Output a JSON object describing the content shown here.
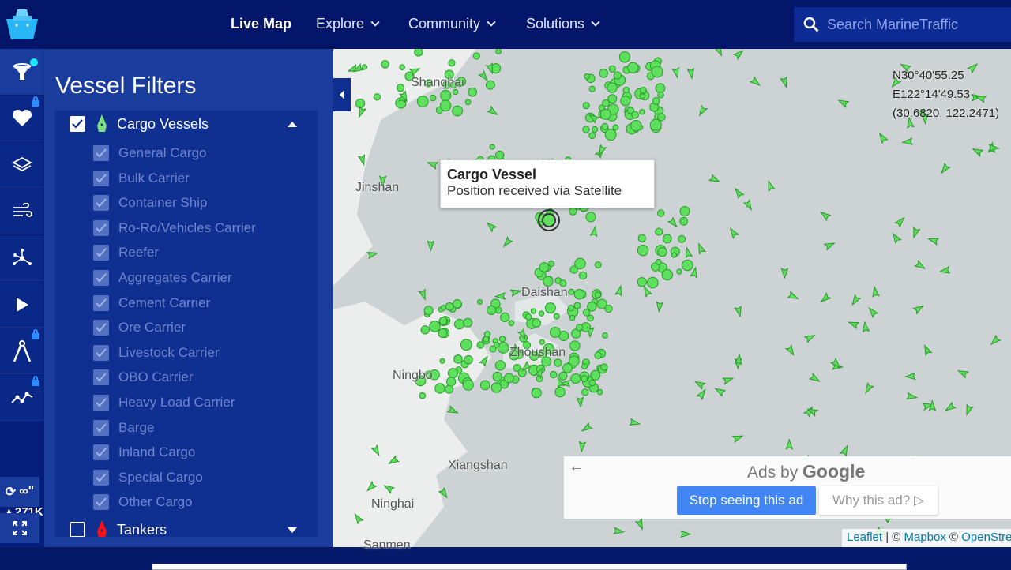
{
  "header": {
    "nav": [
      {
        "label": "Live Map",
        "active": true
      },
      {
        "label": "Explore",
        "dropdown": true
      },
      {
        "label": "Community",
        "dropdown": true
      },
      {
        "label": "Solutions",
        "dropdown": true
      }
    ],
    "search_placeholder": "Search MarineTraffic"
  },
  "rail": {
    "items": [
      {
        "icon": "filter-icon",
        "active": true,
        "badge": true
      },
      {
        "icon": "heart-icon",
        "locked": true
      },
      {
        "icon": "layers-icon"
      },
      {
        "icon": "wind-icon"
      },
      {
        "icon": "network-icon"
      },
      {
        "icon": "play-icon"
      },
      {
        "icon": "measure-icon",
        "locked": true
      },
      {
        "icon": "chart-line-icon",
        "locked": true
      }
    ],
    "vessel_count": "271K",
    "refresh_label": "∞\"",
    "fullscreen_icon": "expand-icon"
  },
  "panel": {
    "title": "Vessel Filters",
    "categories": [
      {
        "label": "Cargo Vessels",
        "checked": true,
        "expanded": true,
        "color": "#7ee07e",
        "subtypes": [
          "General Cargo",
          "Bulk Carrier",
          "Container Ship",
          "Ro-Ro/Vehicles Carrier",
          "Reefer",
          "Aggregates Carrier",
          "Cement Carrier",
          "Ore Carrier",
          "Livestock Carrier",
          "OBO Carrier",
          "Heavy Load Carrier",
          "Barge",
          "Inland Cargo",
          "Special Cargo",
          "Other Cargo"
        ]
      },
      {
        "label": "Tankers",
        "checked": false,
        "expanded": false,
        "color": "#ff1010"
      }
    ]
  },
  "map": {
    "cities": [
      "Shanghai",
      "Jinshan",
      "Daishan",
      "Zhoushan",
      "Ningbo",
      "Xiangshan",
      "Ninghai",
      "Sanmen"
    ],
    "coords": {
      "lat": "N30°40'55.25",
      "lon": "E122°14'49.53",
      "decimal": "(30.6820, 122.2471)"
    },
    "tooltip": {
      "title": "Cargo Vessel",
      "text": "Position received via Satellite"
    },
    "vessel_color": "#5ee05e",
    "attribution": {
      "leaflet": "Leaflet",
      "sep": " | © ",
      "mapbox": "Mapbox",
      "sep2": " © ",
      "osm": "OpenStreetMap"
    }
  },
  "ad": {
    "ads_by": "Ads by",
    "google": "Google",
    "stop": "Stop seeing this ad",
    "why": "Why this ad?"
  }
}
